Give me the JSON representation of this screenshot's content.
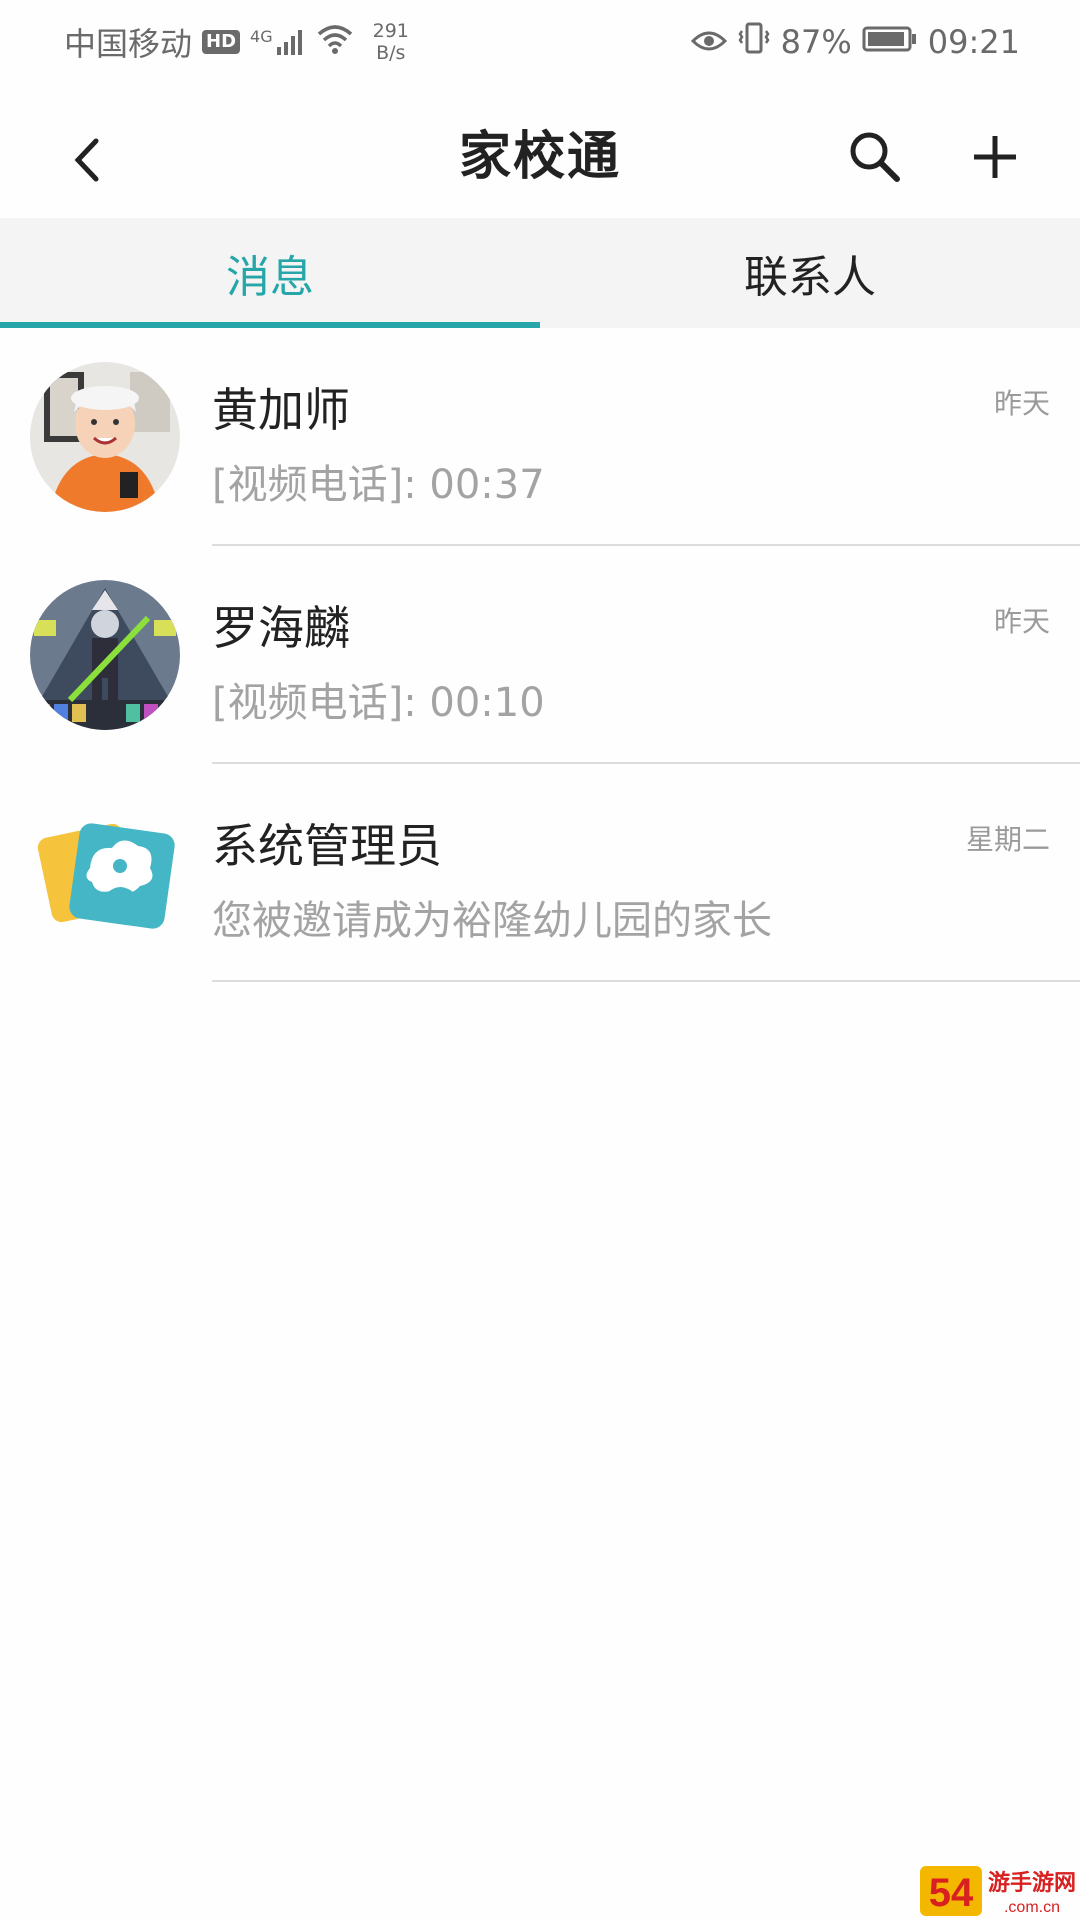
{
  "status_bar": {
    "carrier": "中国移动",
    "hd": "HD",
    "network": "4G",
    "speed_value": "291",
    "speed_unit": "B/s",
    "battery_percent": "87%",
    "time": "09:21"
  },
  "header": {
    "title": "家校通"
  },
  "tabs": [
    {
      "label": "消息",
      "active": true
    },
    {
      "label": "联系人",
      "active": false
    }
  ],
  "conversations": [
    {
      "name": "黄加师",
      "preview": "[视频电话]: 00:37",
      "time": "昨天",
      "avatar": "child-photo-avatar"
    },
    {
      "name": "罗海麟",
      "preview": "[视频电话]: 00:10",
      "time": "昨天",
      "avatar": "game-character-avatar"
    },
    {
      "name": "系统管理员",
      "preview": "您被邀请成为裕隆幼儿园的家长",
      "time": "星期二",
      "avatar": "school-logo-avatar"
    }
  ],
  "watermark": {
    "text": "54游手游网",
    "domain": ".com.cn"
  },
  "colors": {
    "accent": "#26a6a8",
    "tab_bg": "#f4f4f4",
    "secondary_text": "#a3a3a3",
    "divider": "#dcdcdc"
  }
}
